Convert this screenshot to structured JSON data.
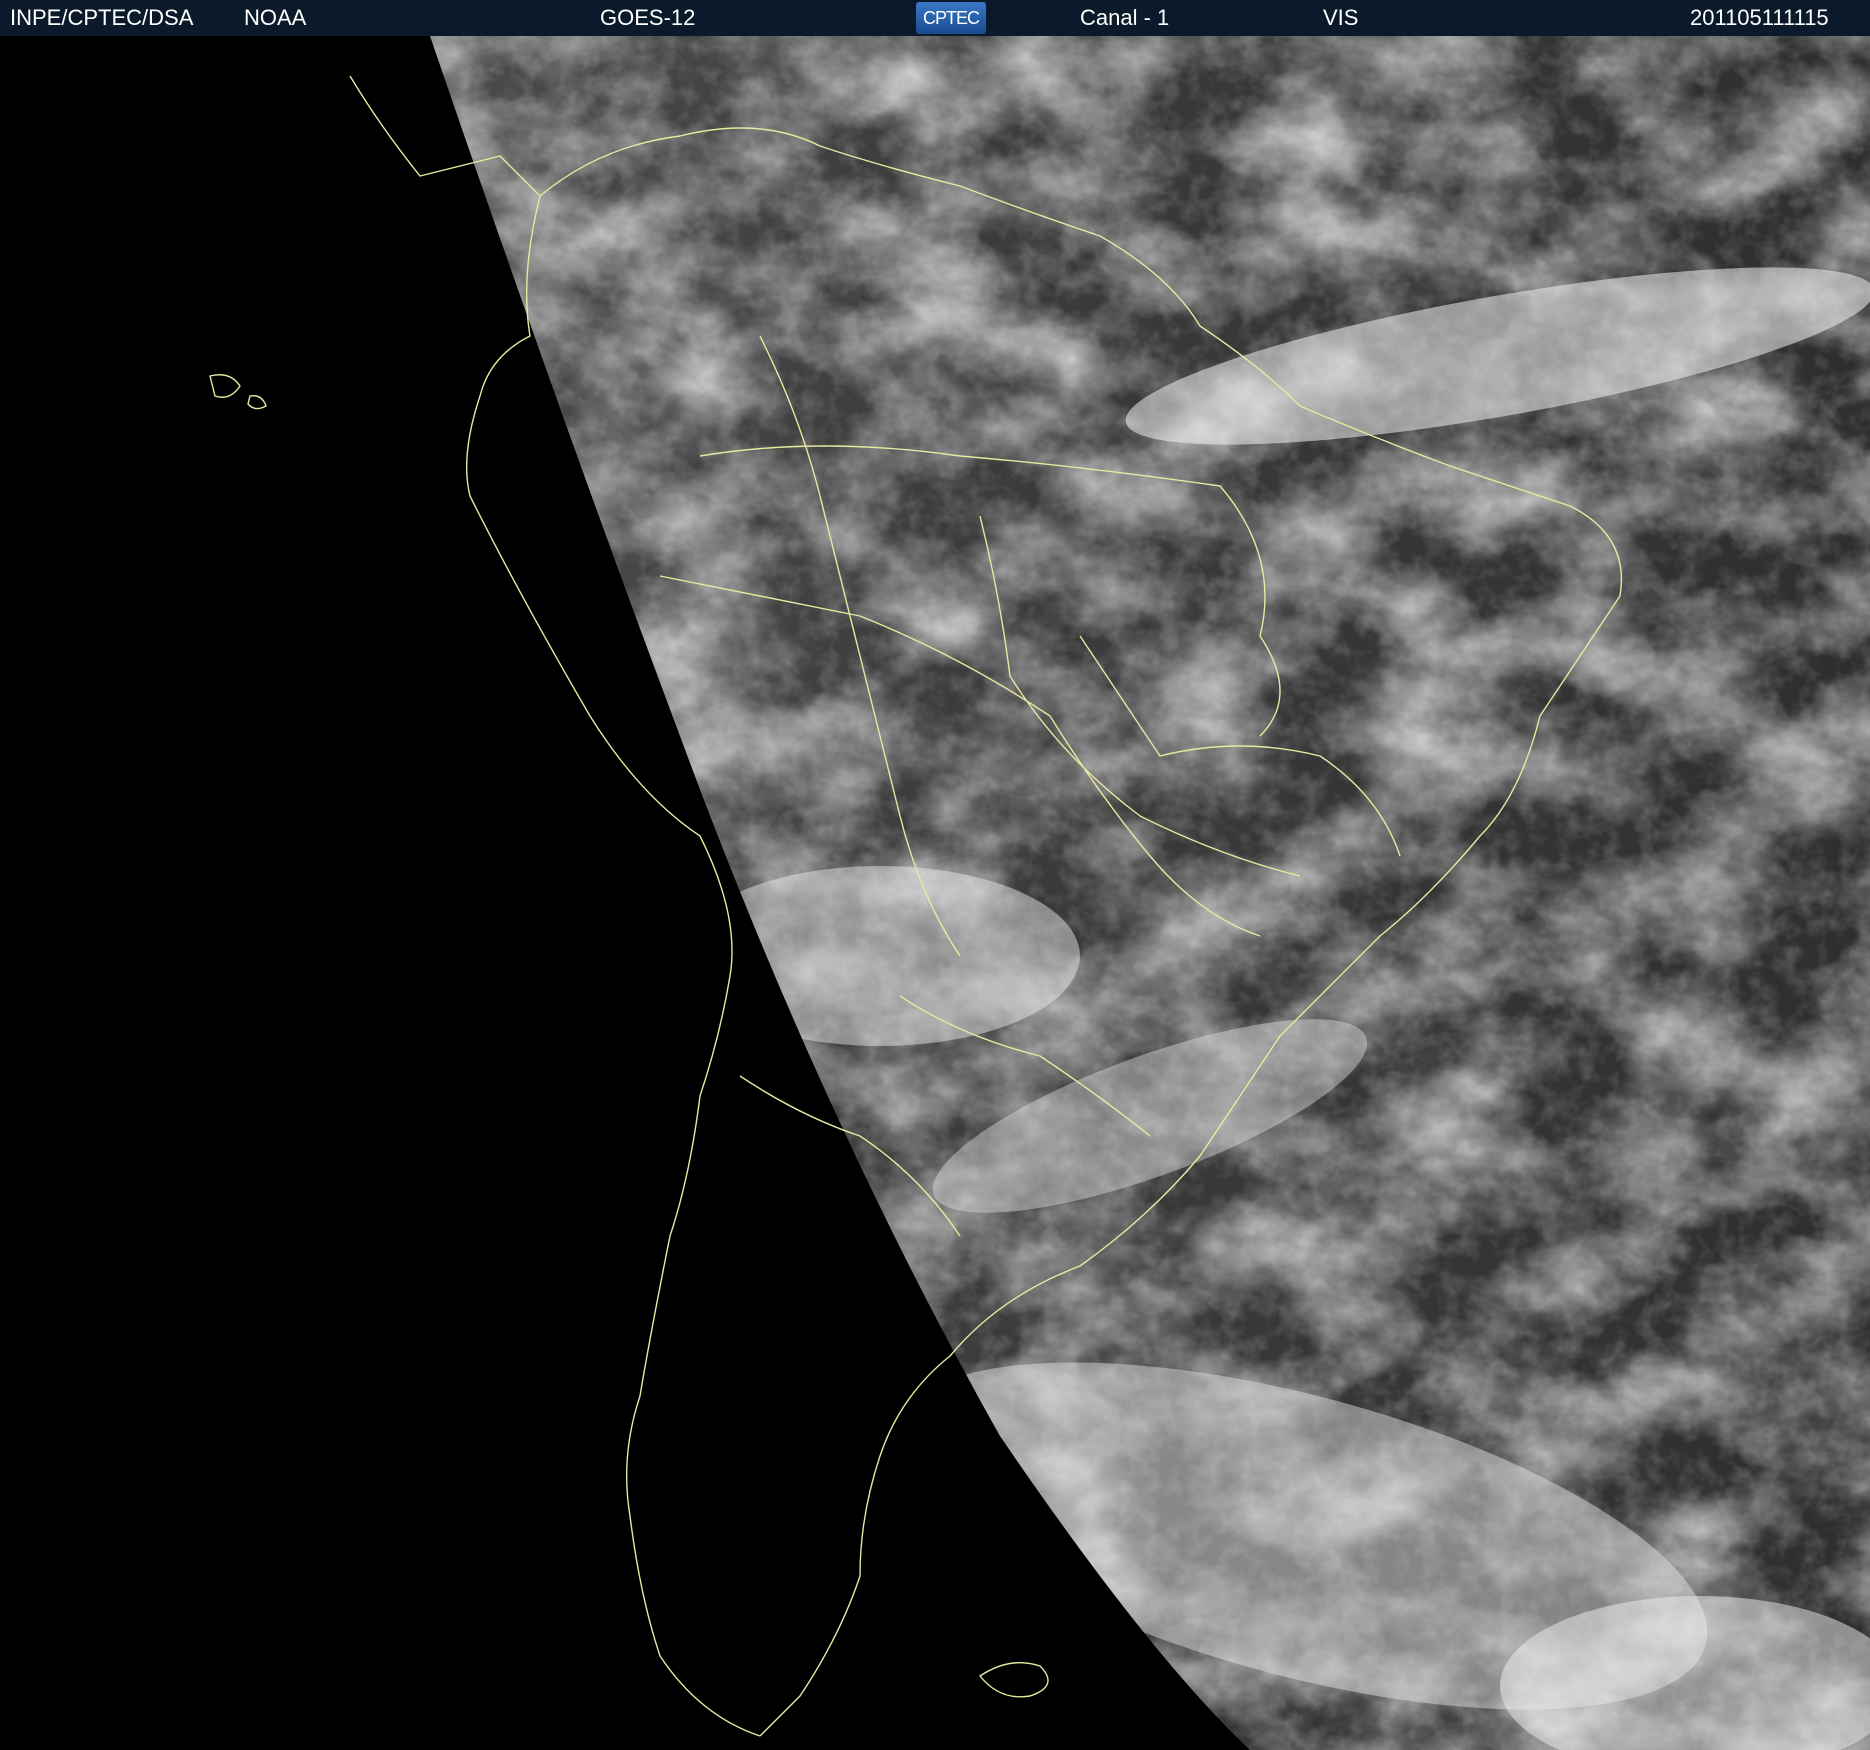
{
  "header": {
    "institution": "INPE/CPTEC/DSA",
    "agency": "NOAA",
    "satellite": "GOES-12",
    "logo_text": "CPTEC",
    "channel": "Canal - 1",
    "band": "VIS",
    "timestamp": "201105111115"
  },
  "colors": {
    "header_bg": "#0a1a2a",
    "boundary_lines": "#e8e8a0",
    "space_bg": "#000000"
  }
}
